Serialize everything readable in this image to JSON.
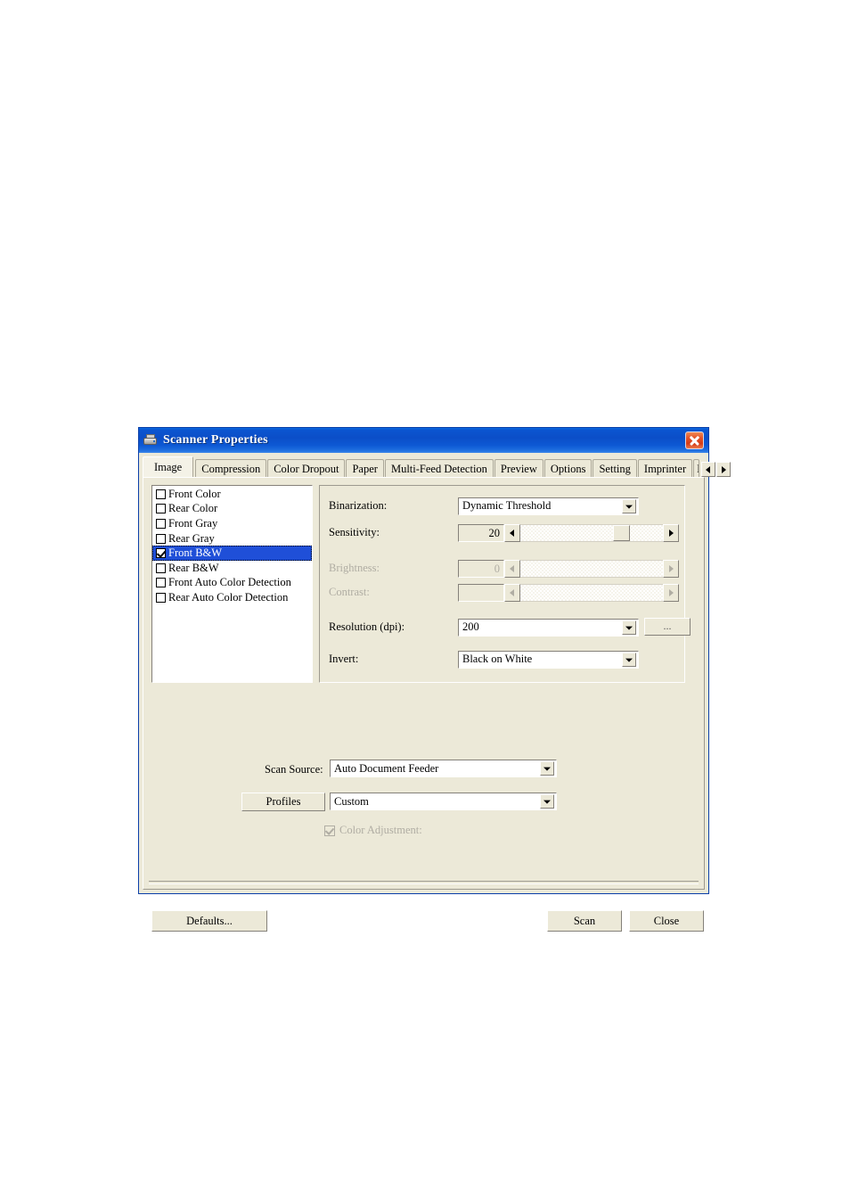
{
  "window": {
    "title": "Scanner Properties",
    "icon": "scanner-icon",
    "close_label": "×",
    "accent_titlebar": "#0b4ec8",
    "face_color": "#ece9d8",
    "selection_color": "#1f4fd8"
  },
  "tabs": {
    "items": [
      {
        "label": "Image",
        "active": true
      },
      {
        "label": "Compression",
        "active": false
      },
      {
        "label": "Color Dropout",
        "active": false
      },
      {
        "label": "Paper",
        "active": false
      },
      {
        "label": "Multi-Feed Detection",
        "active": false
      },
      {
        "label": "Preview",
        "active": false
      },
      {
        "label": "Options",
        "active": false
      },
      {
        "label": "Setting",
        "active": false
      },
      {
        "label": "Imprinter",
        "active": false
      },
      {
        "label": "In",
        "active": false,
        "clipped": true
      }
    ],
    "scroll_left": "◄",
    "scroll_right": "►"
  },
  "image_sources": [
    {
      "label": "Front Color",
      "checked": false,
      "selected": false
    },
    {
      "label": "Rear Color",
      "checked": false,
      "selected": false
    },
    {
      "label": "Front Gray",
      "checked": false,
      "selected": false
    },
    {
      "label": "Rear Gray",
      "checked": false,
      "selected": false
    },
    {
      "label": "Front B&W",
      "checked": true,
      "selected": true
    },
    {
      "label": "Rear B&W",
      "checked": false,
      "selected": false
    },
    {
      "label": "Front Auto Color Detection",
      "checked": false,
      "selected": false
    },
    {
      "label": "Rear Auto Color Detection",
      "checked": false,
      "selected": false
    }
  ],
  "settings": {
    "binarization": {
      "label": "Binarization:",
      "value": "Dynamic Threshold",
      "enabled": true
    },
    "sensitivity": {
      "label": "Sensitivity:",
      "value": "20",
      "enabled": true,
      "thumb_percent": 65
    },
    "brightness": {
      "label": "Brightness:",
      "value": "0",
      "enabled": false,
      "thumb_percent": 0
    },
    "contrast": {
      "label": "Contrast:",
      "value": "",
      "enabled": false,
      "thumb_percent": 0
    },
    "resolution": {
      "label": "Resolution (dpi):",
      "value": "200",
      "enabled": true,
      "browse_label": "..."
    },
    "invert": {
      "label": "Invert:",
      "value": "Black on White",
      "enabled": true
    }
  },
  "lower": {
    "scan_source_label": "Scan Source:",
    "scan_source_value": "Auto Document Feeder",
    "profiles_button": "Profiles",
    "profiles_value": "Custom",
    "color_adjustment_label": "Color Adjustment:",
    "color_adjustment_checked": true,
    "color_adjustment_enabled": false
  },
  "footer": {
    "defaults": "Defaults...",
    "scan": "Scan",
    "close": "Close"
  }
}
